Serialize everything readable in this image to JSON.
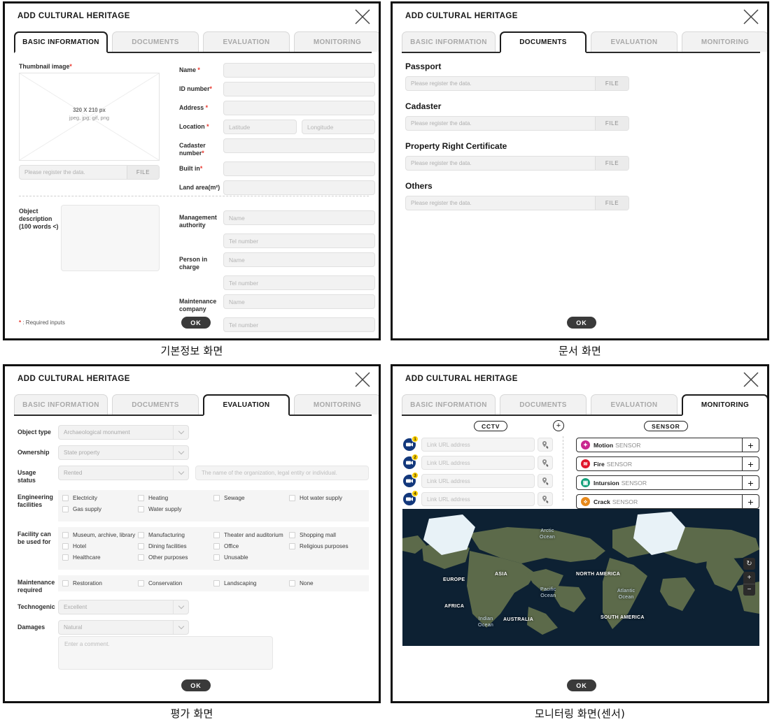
{
  "dialog": {
    "title": "ADD CULTURAL HERITAGE",
    "close_icon": "close-x-icon",
    "ok_label": "OK"
  },
  "tabs": [
    {
      "label": "BASIC INFORMATION"
    },
    {
      "label": "DOCUMENTS"
    },
    {
      "label": "EVALUATION"
    },
    {
      "label": "MONITORING"
    }
  ],
  "captions": {
    "basic": "기본정보 화면",
    "documents": "문서 화면",
    "evaluation": "평가 화면",
    "monitoring": "모니터링 화면(센서)"
  },
  "basic": {
    "thumbnail_label": "Thumbnail image",
    "thumbnail_size": "320 X 210 px",
    "thumbnail_formats": "jpeg, jpg, gif, png",
    "file_placeholder": "Please register the data.",
    "file_button": "FILE",
    "object_description_label": "Object description\n(100 words <)",
    "required_note": "* : Required inputs",
    "fields": [
      {
        "label": "Name",
        "required": true,
        "placeholder": ""
      },
      {
        "label": "ID number",
        "required": true,
        "placeholder": ""
      },
      {
        "label": "Address",
        "required": true,
        "placeholder": ""
      },
      {
        "label": "Location",
        "required": true,
        "placeholder": "Latitude",
        "placeholder2": "Longitude"
      },
      {
        "label": "Cadaster number",
        "required": true,
        "placeholder": ""
      },
      {
        "label": "Built in",
        "required": true,
        "placeholder": ""
      },
      {
        "label": "Land area(m²)",
        "required": false,
        "placeholder": ""
      }
    ],
    "contacts": [
      {
        "label": "Management authority",
        "name_placeholder": "Name",
        "tel_placeholder": "Tel number"
      },
      {
        "label": "Person in charge",
        "name_placeholder": "Name",
        "tel_placeholder": "Tel number"
      },
      {
        "label": "Maintenance company",
        "name_placeholder": "Name",
        "tel_placeholder": "Tel number"
      }
    ]
  },
  "documents": {
    "file_placeholder": "Please register the data.",
    "file_button": "FILE",
    "groups": [
      {
        "title": "Passport"
      },
      {
        "title": "Cadaster"
      },
      {
        "title": "Property Right Certificate"
      },
      {
        "title": "Others"
      }
    ]
  },
  "evaluation": {
    "object_type": {
      "label": "Object type",
      "value": "Archaeological monument"
    },
    "ownership": {
      "label": "Ownership",
      "value": "State property"
    },
    "usage_status": {
      "label": "Usage status",
      "value": "Rented",
      "org_placeholder": "The name of the organization, legal entity or individual."
    },
    "engineering": {
      "label": "Engineering facilities",
      "options": [
        "Electricity",
        "Heating",
        "Sewage",
        "Hot water supply",
        "Gas supply",
        "Water supply"
      ]
    },
    "facility_use": {
      "label": "Facility can be used for",
      "options": [
        "Museum, archive, library",
        "Manufacturing",
        "Theater and auditorium",
        "Shopping mall",
        "Hotel",
        "Dining facilities",
        "Office",
        "Religious purposes",
        "Healthcare",
        "Other purposes",
        "Unusable"
      ]
    },
    "maintenance": {
      "label": "Maintenance required",
      "options": [
        "Restoration",
        "Conservation",
        "Landscaping",
        "None"
      ]
    },
    "technogenic": {
      "label": "Technogenic",
      "value": "Excellent"
    },
    "damages": {
      "label": "Damages",
      "value": "Natural"
    },
    "comment_placeholder": "Enter a comment."
  },
  "monitoring": {
    "cctv_label": "CCTV",
    "sensor_label": "SENSOR",
    "add_icon": "plus-icon",
    "cctv_rows": [
      {
        "badge": "1",
        "placeholder": "Link URL address"
      },
      {
        "badge": "2",
        "placeholder": "Link URL address"
      },
      {
        "badge": "3",
        "placeholder": "Link URL address"
      },
      {
        "badge": "4",
        "placeholder": "Link URL address"
      }
    ],
    "sensors": [
      {
        "name": "Motion",
        "suffix": "SENSOR",
        "color": "#c9268f",
        "add": "+"
      },
      {
        "name": "Fire",
        "suffix": "SENSOR",
        "color": "#e0162b",
        "add": "+"
      },
      {
        "name": "Intursion",
        "suffix": "SENSOR",
        "color": "#12a07a",
        "add": "+"
      },
      {
        "name": "Crack",
        "suffix": "SENSOR",
        "color": "#e8891a",
        "add": "+"
      }
    ],
    "map": {
      "continents": [
        "EUROPE",
        "ASIA",
        "AFRICA",
        "AUSTRALIA",
        "NORTH AMERICA",
        "SOUTH AMERICA"
      ],
      "oceans": [
        "Arctic Ocean",
        "Pacific Ocean",
        "Indian Ocean",
        "Atlantic Ocean"
      ],
      "controls": {
        "rotate": "↻",
        "zoom_in": "+",
        "zoom_out": "−"
      }
    }
  }
}
